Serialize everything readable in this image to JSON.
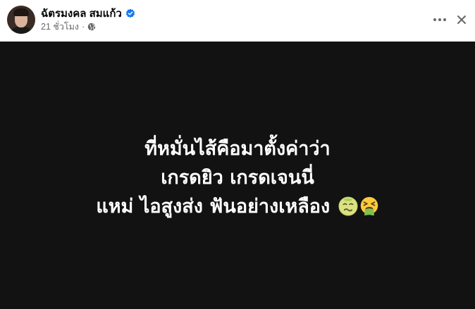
{
  "post": {
    "author": "ฉัตรมงคล สมแก้ว",
    "verified": true,
    "timestamp": "21 ชั่วโมง",
    "separator": "·",
    "privacy_icon": "globe-icon"
  },
  "content": {
    "background_color": "#121212",
    "text_color": "#ffffff",
    "line1": "ที่หมั่นไส้คือมาตั้งค่าว่า",
    "line2": "เกรดยิว เกรดเจนนี่",
    "line3": "แหม่ ไอสูงส่ง ฟันอย่างเหลือง",
    "emojis": [
      "nauseated-face-emoji",
      "vomiting-face-emoji"
    ]
  },
  "icons": {
    "verified": "verified-badge-icon",
    "more": "more-options-icon",
    "close": "close-icon"
  },
  "colors": {
    "verified_blue": "#1877f2",
    "secondary_text": "#65676b",
    "primary_text": "#050505"
  }
}
